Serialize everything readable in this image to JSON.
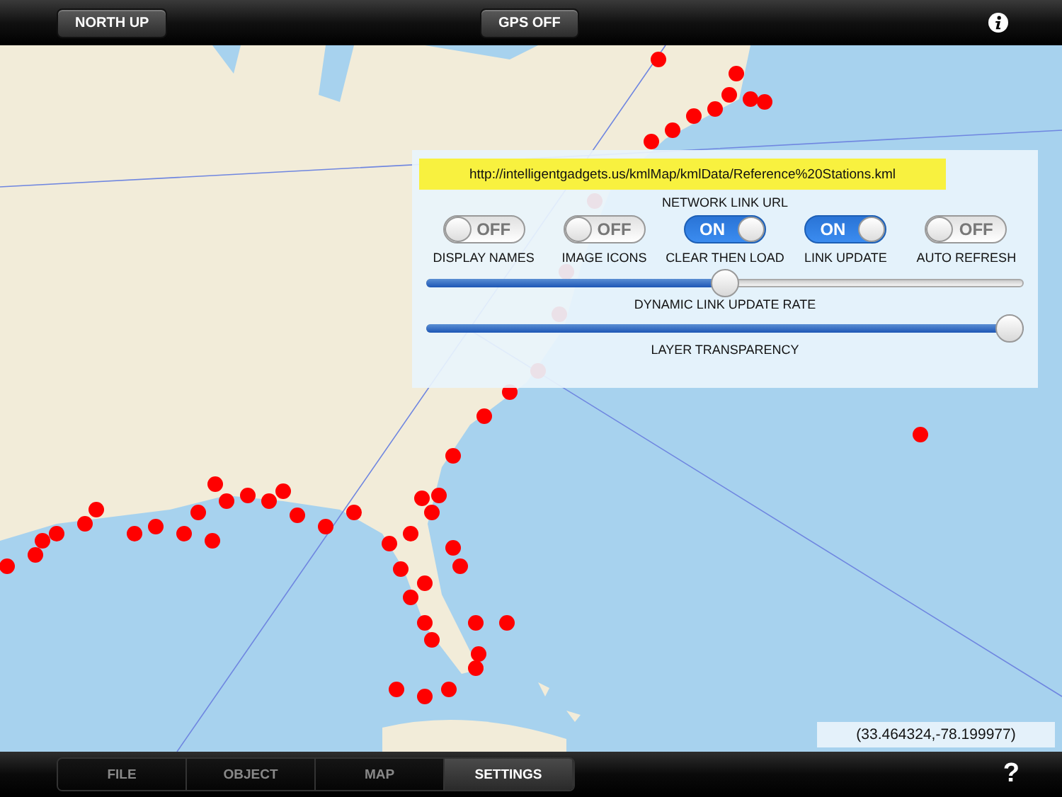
{
  "top_bar": {
    "buttons": [
      {
        "label": "NORTH UP"
      },
      {
        "label": "GPS OFF"
      }
    ]
  },
  "settings_panel": {
    "url": "http://intelligentgadgets.us/kmlMap/kmlData/Reference%20Stations.kml",
    "url_label": "NETWORK LINK URL",
    "toggles": [
      {
        "label": "DISPLAY NAMES",
        "state_text": "OFF",
        "on": false
      },
      {
        "label": "IMAGE ICONS",
        "state_text": "OFF",
        "on": false
      },
      {
        "label": "CLEAR THEN LOAD",
        "state_text": "ON",
        "on": true
      },
      {
        "label": "LINK UPDATE",
        "state_text": "ON",
        "on": true
      },
      {
        "label": "AUTO REFRESH",
        "state_text": "OFF",
        "on": false
      }
    ],
    "sliders": [
      {
        "label": "DYNAMIC LINK UPDATE RATE",
        "level": 0.5
      },
      {
        "label": "LAYER TRANSPARENCY",
        "level": 1
      }
    ]
  },
  "coordinates": "(33.464324,-78.199977)",
  "tabs": [
    {
      "label": "FILE",
      "selected": false
    },
    {
      "label": "OBJECT",
      "selected": false
    },
    {
      "label": "MAP",
      "selected": false
    },
    {
      "label": "SETTINGS",
      "selected": true
    }
  ],
  "help_icon": "?"
}
